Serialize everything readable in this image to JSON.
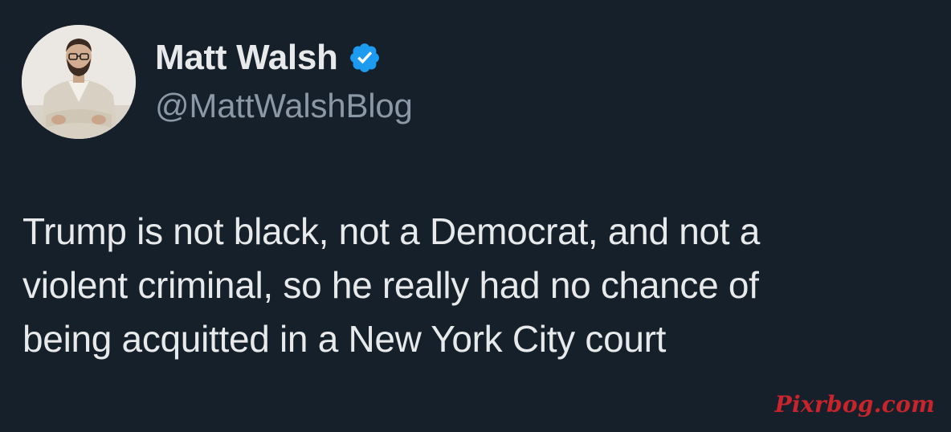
{
  "author": {
    "display_name": "Matt Walsh",
    "handle": "@MattWalshBlog",
    "verified": true,
    "avatar_icon": "profile-photo"
  },
  "tweet": {
    "lines": [
      "Trump is not black, not a Democrat, and not a",
      "violent criminal, so he really had no chance of",
      "being acquitted in a New York City court"
    ]
  },
  "watermark": "Pixrbog.com",
  "colors": {
    "background": "#16202b",
    "text": "#e7e9ea",
    "handle": "#8b98a5",
    "verified_badge": "#1d9bf0",
    "watermark": "#c8242c"
  }
}
